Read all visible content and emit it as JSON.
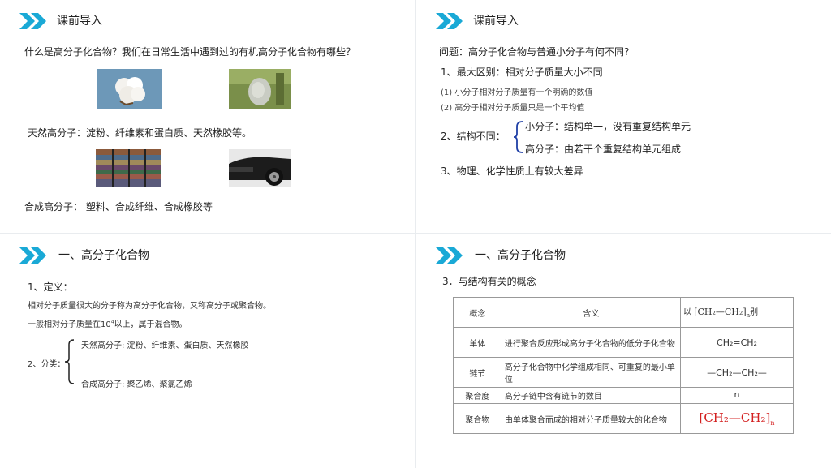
{
  "slides": [
    {
      "title": "课前导入",
      "question": "什么是高分子化合物？我们在日常生活中遇到过的有机高分子化合物有哪些？",
      "natural": "天然高分子：淀粉、纤维素和蛋白质、天然橡胶等。",
      "synthetic": "合成高分子： 塑料、合成纤维、合成橡胶等"
    },
    {
      "title": "课前导入",
      "question": "问题：高分子化合物与普通小分子有何不同?",
      "item1": "1、最大区别：相对分子质量大小不同",
      "item1_a": "(1) 小分子相对分子质量有一个明确的数值",
      "item1_b": "(2) 高分子相对分子质量只是一个平均值",
      "item2": "2、结构不同：",
      "item2_a": "小分子：结构单一，没有重复结构单元",
      "item2_b": "高分子：由若干个重复结构单元组成",
      "item3": "3、物理、化学性质上有较大差异"
    },
    {
      "title": "一、高分子化合物",
      "def_head": "1、定义：",
      "def_line1": "相对分子质量很大的分子称为高分子化合物，又称高分子或聚合物。",
      "def_line2_pre": "一般相对分子质量在10",
      "def_line2_exp": "4",
      "def_line2_post": "以上，属于混合物。",
      "class_head": "2、分类：",
      "class_a": "天然高分子: 淀粉、纤维素、蛋白质、天然橡胶",
      "class_b": "合成高分子:  聚乙烯、聚氯乙烯"
    },
    {
      "title": "一、高分子化合物",
      "subtitle": "3．与结构有关的概念",
      "table": {
        "header": [
          "概念",
          "含义",
          "以"
        ],
        "header_suffix": "别",
        "rows": [
          {
            "term": "单体",
            "meaning": "进行聚合反应形成高分子化合物的低分子化合物",
            "example": "CH₂=CH₂"
          },
          {
            "term": "链节",
            "meaning": "高分子化合物中化学组成相同、可重复的最小单位",
            "example": "—CH₂—CH₂—"
          },
          {
            "term": "聚合度",
            "meaning": "高分子链中含有链节的数目",
            "example": "n"
          },
          {
            "term": "聚合物",
            "meaning": "由单体聚合而成的相对分子质量较大的化合物",
            "example": ""
          }
        ]
      },
      "polymer_header": {
        "left": "[",
        "body": "CH₂—CH₂",
        "right": "]",
        "n": "n"
      },
      "polymer_red": {
        "left": "[",
        "body": "CH₂—CH₂",
        "right": "]",
        "n": "n"
      }
    }
  ],
  "colors": {
    "accent": "#1aa9d6",
    "bracket": "#1f3fa6",
    "red": "#d32020"
  }
}
